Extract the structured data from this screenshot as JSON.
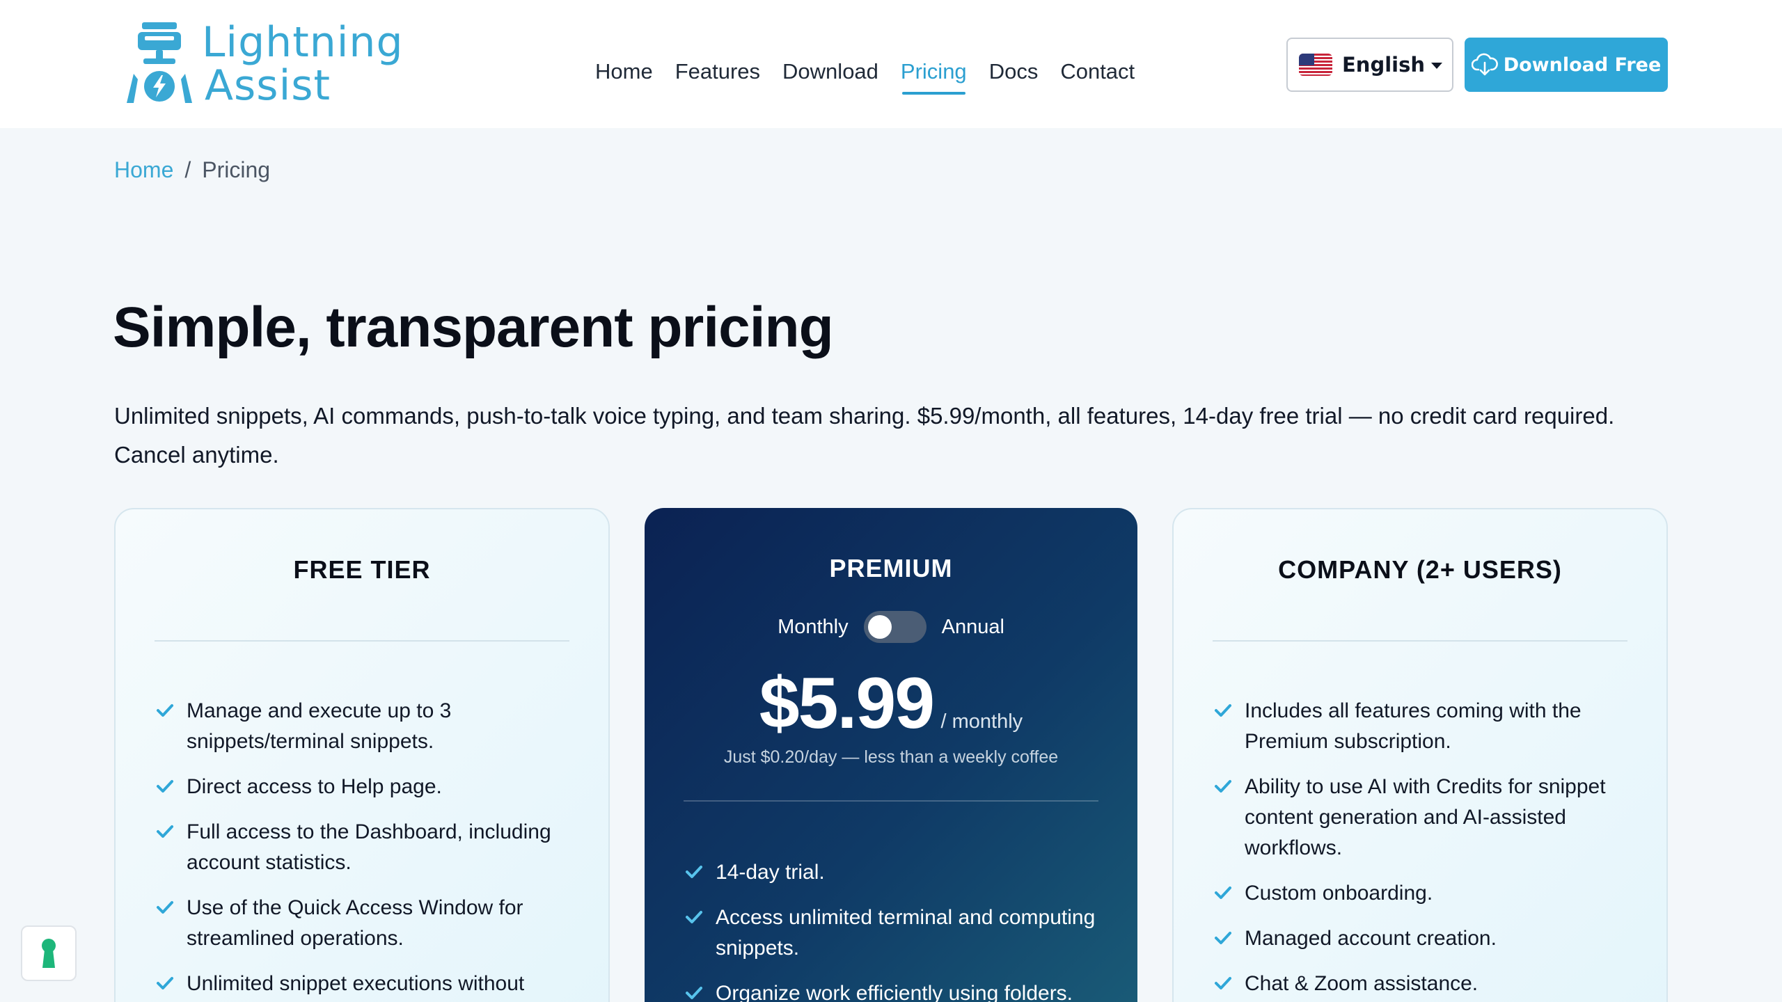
{
  "brand": {
    "name_line1": "Lightning",
    "name_line2": "Assist",
    "color": "#3aa8d4"
  },
  "nav": {
    "items": [
      {
        "label": "Home",
        "active": false
      },
      {
        "label": "Features",
        "active": false
      },
      {
        "label": "Download",
        "active": false
      },
      {
        "label": "Pricing",
        "active": true
      },
      {
        "label": "Docs",
        "active": false
      },
      {
        "label": "Contact",
        "active": false
      }
    ]
  },
  "language": {
    "selected": "English",
    "icon": "us-flag-icon"
  },
  "cta": {
    "download_label": "Download Free",
    "icon": "cloud-download-icon",
    "color": "#2fa7d8"
  },
  "breadcrumb": {
    "home": "Home",
    "separator": "/",
    "current": "Pricing"
  },
  "hero": {
    "title": "Simple, transparent pricing",
    "subtitle": "Unlimited snippets, AI commands, push-to-talk voice typing, and team sharing. $5.99/month, all features, 14-day free trial — no credit card required. Cancel anytime."
  },
  "plans": {
    "free": {
      "title": "FREE TIER",
      "features": [
        "Manage and execute up to 3 snippets/terminal snippets.",
        "Direct access to Help page.",
        "Full access to the Dashboard, including account statistics.",
        "Use of the Quick Access Window for streamlined operations.",
        "Unlimited snippet executions without"
      ]
    },
    "premium": {
      "title": "PREMIUM",
      "toggle_left": "Monthly",
      "toggle_right": "Annual",
      "price": "$5.99",
      "period": "/ monthly",
      "note": "Just $0.20/day — less than a weekly coffee",
      "features": [
        "14-day trial.",
        "Access unlimited terminal and computing snippets.",
        "Organize work efficiently using folders."
      ]
    },
    "company": {
      "title": "COMPANY (2+ USERS)",
      "features": [
        "Includes all features coming with the Premium subscription.",
        "Ability to use AI with Credits for snippet content generation and AI-assisted workflows.",
        "Custom onboarding.",
        "Managed account creation.",
        "Chat & Zoom assistance."
      ]
    }
  },
  "widget": {
    "icon": "keyhole-icon",
    "color": "#1db67a"
  }
}
